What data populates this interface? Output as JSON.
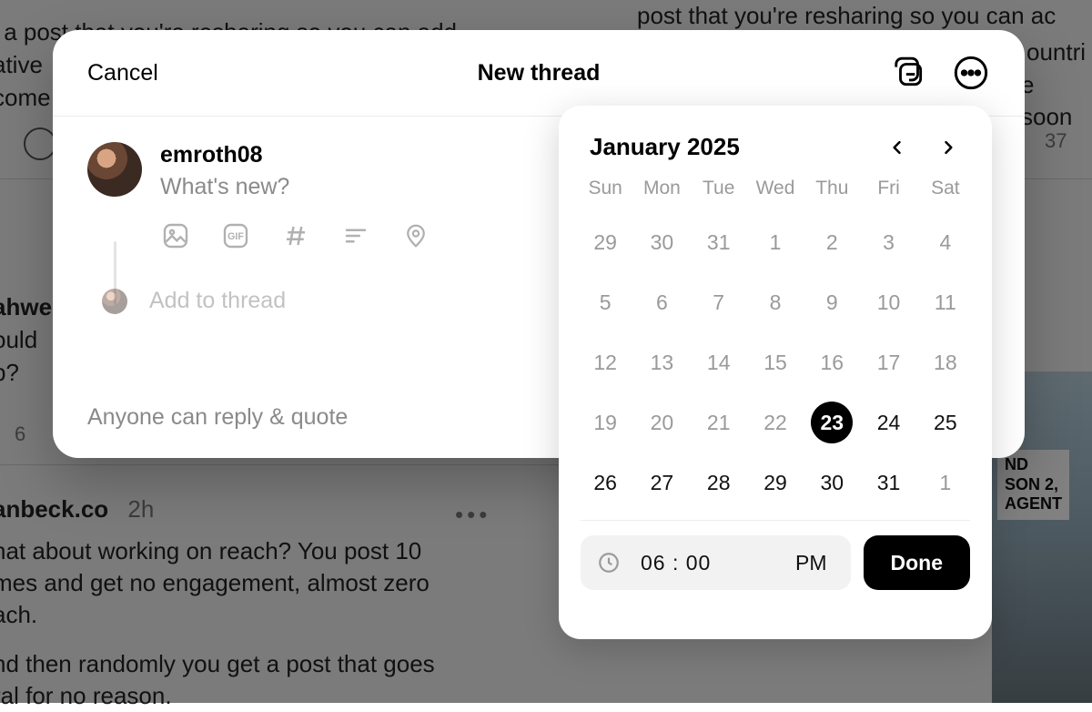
{
  "bg": {
    "line_top": "' a post that you're resharing so you can add",
    "line_top2a": "ative",
    "line_top2b": "come",
    "right_top1": "post that you're resharing so you can ac",
    "right_top2": "ountri",
    "right_top3": "e soon",
    "count_right": "37",
    "left_mid1": "ahwe",
    "left_mid2": "ould",
    "left_mid3": "p?",
    "left_count": "6",
    "user2": "anbeck.co",
    "user2_time": "2h",
    "p2_l1": "hat about working on reach? You post 10",
    "p2_l2": "mes and get no engagement, almost zero",
    "p2_l3": "ach.",
    "p2_l4": "nd then randomly you get a post that goes",
    "p2_l5": "ral for no reason.",
    "marquee_l1": "ND",
    "marquee_l2": "SON 2,",
    "marquee_l3": "AGENT"
  },
  "dialog": {
    "cancel": "Cancel",
    "title": "New thread",
    "username": "emroth08",
    "placeholder": "What's new?",
    "add_to_thread": "Add to thread",
    "reply_setting": "Anyone can reply & quote"
  },
  "calendar": {
    "month_label": "January 2025",
    "dow": [
      "Sun",
      "Mon",
      "Tue",
      "Wed",
      "Thu",
      "Fri",
      "Sat"
    ],
    "weeks": [
      [
        {
          "n": "29",
          "cls": ""
        },
        {
          "n": "30",
          "cls": ""
        },
        {
          "n": "31",
          "cls": ""
        },
        {
          "n": "1",
          "cls": ""
        },
        {
          "n": "2",
          "cls": ""
        },
        {
          "n": "3",
          "cls": ""
        },
        {
          "n": "4",
          "cls": ""
        }
      ],
      [
        {
          "n": "5",
          "cls": ""
        },
        {
          "n": "6",
          "cls": ""
        },
        {
          "n": "7",
          "cls": ""
        },
        {
          "n": "8",
          "cls": ""
        },
        {
          "n": "9",
          "cls": ""
        },
        {
          "n": "10",
          "cls": ""
        },
        {
          "n": "11",
          "cls": ""
        }
      ],
      [
        {
          "n": "12",
          "cls": ""
        },
        {
          "n": "13",
          "cls": ""
        },
        {
          "n": "14",
          "cls": ""
        },
        {
          "n": "15",
          "cls": ""
        },
        {
          "n": "16",
          "cls": ""
        },
        {
          "n": "17",
          "cls": ""
        },
        {
          "n": "18",
          "cls": ""
        }
      ],
      [
        {
          "n": "19",
          "cls": ""
        },
        {
          "n": "20",
          "cls": ""
        },
        {
          "n": "21",
          "cls": ""
        },
        {
          "n": "22",
          "cls": ""
        },
        {
          "n": "23",
          "cls": "sel"
        },
        {
          "n": "24",
          "cls": "cur"
        },
        {
          "n": "25",
          "cls": "cur"
        }
      ],
      [
        {
          "n": "26",
          "cls": "cur"
        },
        {
          "n": "27",
          "cls": "cur"
        },
        {
          "n": "28",
          "cls": "cur"
        },
        {
          "n": "29",
          "cls": "cur"
        },
        {
          "n": "30",
          "cls": "cur"
        },
        {
          "n": "31",
          "cls": "cur"
        },
        {
          "n": "1",
          "cls": ""
        }
      ]
    ],
    "time": "06 : 00",
    "ampm": "PM",
    "done": "Done"
  }
}
